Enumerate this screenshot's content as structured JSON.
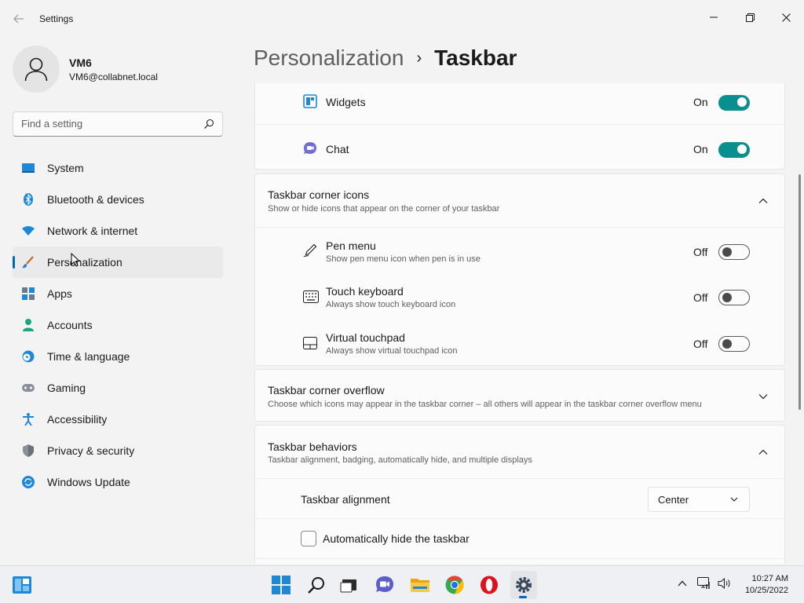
{
  "window": {
    "title": "Settings"
  },
  "profile": {
    "name": "VM6",
    "email": "VM6@collabnet.local"
  },
  "search": {
    "placeholder": "Find a setting"
  },
  "sidebar": {
    "items": [
      {
        "label": "System",
        "icon": "system-icon"
      },
      {
        "label": "Bluetooth & devices",
        "icon": "bluetooth-icon"
      },
      {
        "label": "Network & internet",
        "icon": "wifi-icon"
      },
      {
        "label": "Personalization",
        "icon": "brush-icon",
        "active": true
      },
      {
        "label": "Apps",
        "icon": "apps-icon"
      },
      {
        "label": "Accounts",
        "icon": "accounts-icon"
      },
      {
        "label": "Time & language",
        "icon": "clock-globe-icon"
      },
      {
        "label": "Gaming",
        "icon": "gamepad-icon"
      },
      {
        "label": "Accessibility",
        "icon": "accessibility-icon"
      },
      {
        "label": "Privacy & security",
        "icon": "shield-icon"
      },
      {
        "label": "Windows Update",
        "icon": "update-icon"
      }
    ]
  },
  "header": {
    "parent": "Personalization",
    "separator": "›",
    "current": "Taskbar"
  },
  "taskbar_items": {
    "widgets": {
      "label": "Widgets",
      "state": "On"
    },
    "chat": {
      "label": "Chat",
      "state": "On"
    }
  },
  "corner_icons": {
    "title": "Taskbar corner icons",
    "subtitle": "Show or hide icons that appear on the corner of your taskbar",
    "items": [
      {
        "label": "Pen menu",
        "sub": "Show pen menu icon when pen is in use",
        "state": "Off"
      },
      {
        "label": "Touch keyboard",
        "sub": "Always show touch keyboard icon",
        "state": "Off"
      },
      {
        "label": "Virtual touchpad",
        "sub": "Always show virtual touchpad icon",
        "state": "Off"
      }
    ]
  },
  "corner_overflow": {
    "title": "Taskbar corner overflow",
    "subtitle": "Choose which icons may appear in the taskbar corner – all others will appear in the taskbar corner overflow menu"
  },
  "behaviors": {
    "title": "Taskbar behaviors",
    "subtitle": "Taskbar alignment, badging, automatically hide, and multiple displays",
    "alignment_label": "Taskbar alignment",
    "alignment_value": "Center",
    "autohide_label": "Automatically hide the taskbar",
    "autohide_checked": false
  },
  "colors": {
    "accent": "#0067c0",
    "toggle_on": "#0a8f8f"
  },
  "clock": {
    "time": "10:27 AM",
    "date": "10/25/2022"
  }
}
